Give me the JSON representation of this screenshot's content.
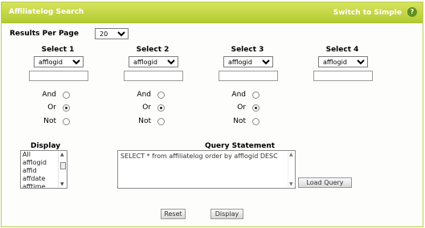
{
  "header": {
    "title": "Affiliatelog  Search",
    "switch_label": "Switch to Simple",
    "help_glyph": "?"
  },
  "results_per_page": {
    "label": "Results Per Page",
    "value": "20"
  },
  "selects": [
    {
      "label": "Select 1",
      "field": "afflogid",
      "value": "",
      "mode": "Or"
    },
    {
      "label": "Select 2",
      "field": "afflogid",
      "value": "",
      "mode": "Or"
    },
    {
      "label": "Select 3",
      "field": "afflogid",
      "value": "",
      "mode": "Or"
    },
    {
      "label": "Select 4",
      "field": "afflogid",
      "value": ""
    }
  ],
  "logic_labels": {
    "and": "And",
    "or": "Or",
    "not": "Not"
  },
  "display": {
    "label": "Display",
    "items": [
      "All",
      "afflogid",
      "affid",
      "affdate",
      "afftime"
    ]
  },
  "query": {
    "label": "Query Statement",
    "text": "SELECT * from affiliatelog order by afflogid DESC",
    "load_label": "Load Query"
  },
  "buttons": {
    "reset": "Reset",
    "display": "Display"
  },
  "colors": {
    "header_top": "#d7e45c",
    "header_bottom": "#b3cb33",
    "border": "#b9cf59",
    "help_bg": "#5e8f1e"
  },
  "icons": [
    "help-icon",
    "dropdown-arrow-icon",
    "scroll-up-icon",
    "scroll-down-icon"
  ]
}
